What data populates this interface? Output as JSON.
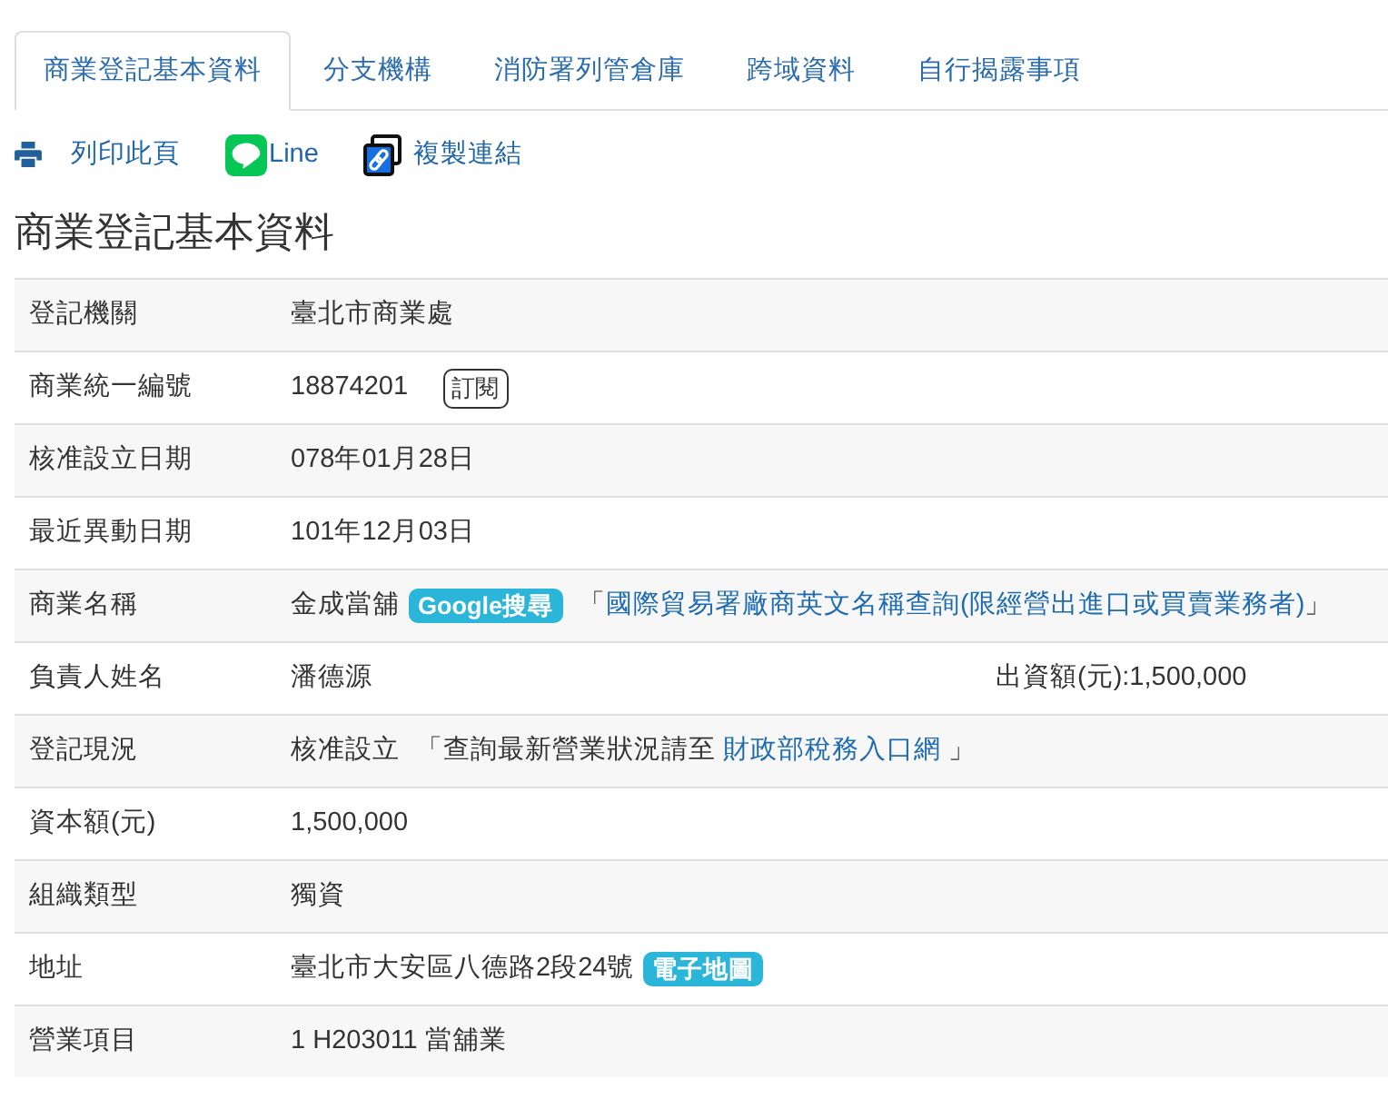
{
  "tabs": [
    {
      "label": "商業登記基本資料",
      "selected": true
    },
    {
      "label": "分支機構",
      "selected": false
    },
    {
      "label": "消防署列管倉庫",
      "selected": false
    },
    {
      "label": "跨域資料",
      "selected": false
    },
    {
      "label": "自行揭露事項",
      "selected": false
    }
  ],
  "toolbar": [
    {
      "kind": "print",
      "label": "列印此頁"
    },
    {
      "kind": "line",
      "label": "Line"
    },
    {
      "kind": "copy-link",
      "label": "複製連結"
    }
  ],
  "heading": "商業登記基本資料",
  "rows": [
    {
      "label": "登記機關",
      "parts": [
        {
          "kind": "text",
          "text": "臺北市商業處"
        }
      ]
    },
    {
      "label": "商業統一編號",
      "parts": [
        {
          "kind": "text",
          "text": "18874201"
        },
        {
          "kind": "button",
          "text": "訂閱"
        }
      ]
    },
    {
      "label": "核准設立日期",
      "parts": [
        {
          "kind": "text",
          "text": "078年01月28日"
        }
      ]
    },
    {
      "label": "最近異動日期",
      "parts": [
        {
          "kind": "text",
          "text": "101年12月03日"
        }
      ]
    },
    {
      "label": "商業名稱",
      "parts": [
        {
          "kind": "text",
          "text": "金成當舖"
        },
        {
          "kind": "badge",
          "text": "Google搜尋"
        },
        {
          "kind": "quote",
          "before": "「",
          "link": "國際貿易署廠商英文名稱查詢(限經營出進口或買賣業務者)",
          "after": "」"
        }
      ]
    },
    {
      "label": "負責人姓名",
      "parts": [
        {
          "kind": "text",
          "text": "潘德源"
        },
        {
          "kind": "aside",
          "text": "出資額(元):1,500,000"
        }
      ]
    },
    {
      "label": "登記現況",
      "parts": [
        {
          "kind": "text",
          "text": "核准設立"
        },
        {
          "kind": "quote",
          "before": "「查詢最新營業狀況請至 ",
          "link": "財政部稅務入口網",
          "after": " 」"
        }
      ]
    },
    {
      "label": "資本額(元)",
      "parts": [
        {
          "kind": "text",
          "text": "1,500,000"
        }
      ]
    },
    {
      "label": "組織類型",
      "parts": [
        {
          "kind": "text",
          "text": "獨資"
        }
      ]
    },
    {
      "label": "地址",
      "parts": [
        {
          "kind": "text",
          "text": "臺北市大安區八德路2段24號"
        },
        {
          "kind": "badge",
          "text": "電子地圖"
        }
      ]
    },
    {
      "label": "營業項目",
      "parts": [
        {
          "kind": "text",
          "text": "1 H203011 當舖業"
        }
      ]
    }
  ]
}
